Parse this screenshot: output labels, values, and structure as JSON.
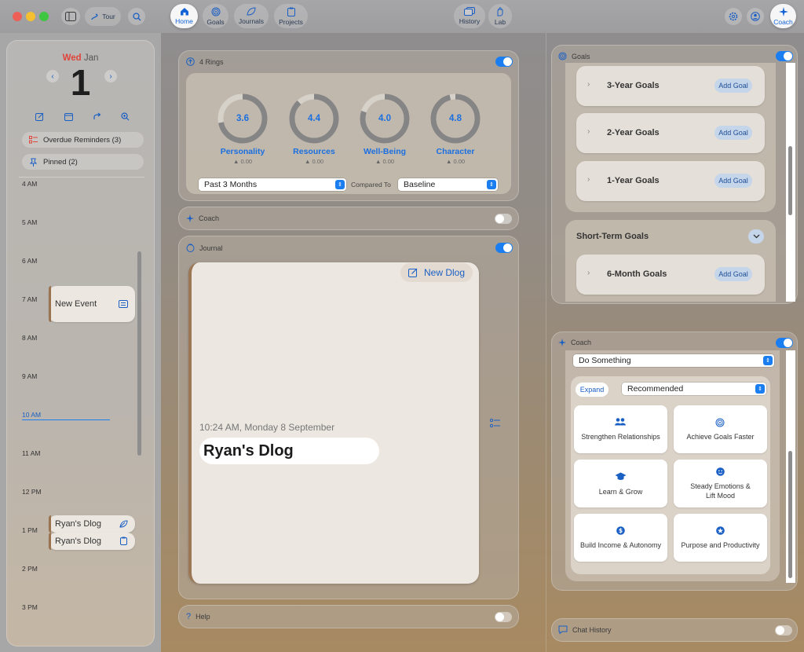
{
  "toolbar": {
    "tour_label": "Tour",
    "nav": [
      {
        "label": "Home"
      },
      {
        "label": "Goals"
      },
      {
        "label": "Journals"
      },
      {
        "label": "Projects"
      }
    ],
    "history_label": "History",
    "lab_label": "Lab",
    "coach_label": "Coach"
  },
  "calendar": {
    "weekday": "Wed",
    "month": "Jan",
    "day": "1",
    "overdue_label": "Overdue Reminders (3)",
    "pinned_label": "Pinned (2)",
    "hours": [
      "4 AM",
      "5 AM",
      "6 AM",
      "7 AM",
      "8 AM",
      "9 AM",
      "10 AM",
      "11 AM",
      "12 PM",
      "1 PM",
      "2 PM",
      "3 PM"
    ],
    "events": [
      {
        "title": "New Event"
      },
      {
        "title": "Ryan's Dlog"
      },
      {
        "title": "Ryan's Dlog"
      }
    ]
  },
  "rings": {
    "title": "4 Rings",
    "items": [
      {
        "name": "Personality",
        "value": "3.6",
        "delta": "▲ 0.00",
        "fraction": 0.72
      },
      {
        "name": "Resources",
        "value": "4.4",
        "delta": "▲ 0.00",
        "fraction": 0.88
      },
      {
        "name": "Well-Being",
        "value": "4.0",
        "delta": "▲ 0.00",
        "fraction": 0.8
      },
      {
        "name": "Character",
        "value": "4.8",
        "delta": "▲ 0.00",
        "fraction": 0.96
      }
    ],
    "period": "Past 3 Months",
    "compared_to_label": "Compared To",
    "baseline": "Baseline"
  },
  "coach_panel": {
    "title": "Coach"
  },
  "journal": {
    "title": "Journal",
    "new_dlog_label": "New Dlog",
    "timestamp": "10:24 AM, Monday 8 September",
    "entry_title": "Ryan's Dlog"
  },
  "help": {
    "title": "Help"
  },
  "goals": {
    "title": "Goals",
    "long_term": [
      {
        "label": "3-Year Goals",
        "action": "Add Goal"
      },
      {
        "label": "2-Year Goals",
        "action": "Add Goal"
      },
      {
        "label": "1-Year Goals",
        "action": "Add Goal"
      }
    ],
    "short_term_title": "Short-Term Goals",
    "short_term": [
      {
        "label": "6-Month Goals",
        "action": "Add Goal"
      }
    ]
  },
  "coach": {
    "title": "Coach",
    "mode": "Do Something",
    "expand_label": "Expand",
    "filter": "Recommended",
    "tiles": [
      {
        "label": "Strengthen Relationships",
        "icon": "people-icon"
      },
      {
        "label": "Achieve Goals Faster",
        "icon": "target-icon"
      },
      {
        "label": "Learn & Grow",
        "icon": "graduation-cap-icon"
      },
      {
        "label": "Steady Emotions &\nLift Mood",
        "icon": "smiley-icon"
      },
      {
        "label": "Build Income & Autonomy",
        "icon": "dollar-icon"
      },
      {
        "label": "Purpose and Productivity",
        "icon": "star-icon"
      }
    ]
  },
  "chat_history": {
    "title": "Chat History"
  },
  "colors": {
    "accent": "#1a7df0",
    "today": "#e0443a"
  }
}
